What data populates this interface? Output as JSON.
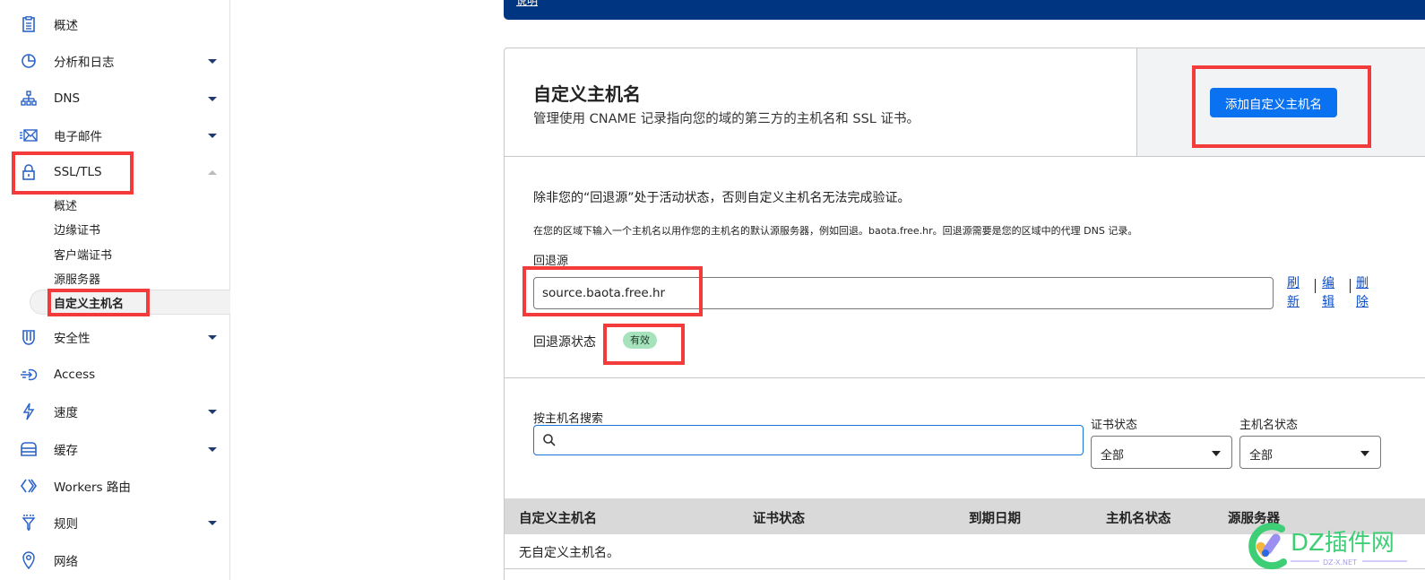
{
  "banner": {
    "link_text": "说明"
  },
  "sidebar": {
    "items": [
      {
        "label": "概述",
        "icon": "clipboard-icon",
        "has_caret": false
      },
      {
        "label": "分析和日志",
        "icon": "pie-chart-icon",
        "has_caret": true
      },
      {
        "label": "DNS",
        "icon": "network-tree-icon",
        "has_caret": true
      },
      {
        "label": "电子邮件",
        "icon": "envelope-icon",
        "has_caret": true
      },
      {
        "label": "SSL/TLS",
        "icon": "lock-icon",
        "has_caret": true,
        "expanded": true
      },
      {
        "label": "安全性",
        "icon": "shield-icon",
        "has_caret": true
      },
      {
        "label": "Access",
        "icon": "access-icon",
        "has_caret": false
      },
      {
        "label": "速度",
        "icon": "lightning-icon",
        "has_caret": true
      },
      {
        "label": "缓存",
        "icon": "storage-icon",
        "has_caret": true
      },
      {
        "label": "Workers 路由",
        "icon": "workers-icon",
        "has_caret": false
      },
      {
        "label": "规则",
        "icon": "filter-icon",
        "has_caret": true
      },
      {
        "label": "网络",
        "icon": "location-pin-icon",
        "has_caret": false
      }
    ],
    "ssl_sub_items": [
      {
        "label": "概述"
      },
      {
        "label": "边缘证书"
      },
      {
        "label": "客户端证书"
      },
      {
        "label": "源服务器"
      },
      {
        "label": "自定义主机名",
        "active": true
      }
    ]
  },
  "main": {
    "title": "自定义主机名",
    "description": "管理使用 CNAME 记录指向您的域的第三方的主机名和 SSL 证书。",
    "add_button": "添加自定义主机名",
    "warning": "除非您的“回退源”处于活动状态，否则自定义主机名无法完成验证。",
    "help": "在您的区域下输入一个主机名以用作您的主机名的默认源服务器，例如回退。baota.free.hr。回退源需要是您的区域中的代理 DNS 记录。",
    "fallback_label": "回退源",
    "fallback_value": "source.baota.free.hr",
    "actions": {
      "refresh": "刷新",
      "edit": "编辑",
      "delete": "删除"
    },
    "status_label": "回退源状态",
    "status_value": "有效",
    "status_color": "#a6e3bd",
    "search_label": "按主机名搜索",
    "search_value": "",
    "cert_status_label": "证书状态",
    "cert_status_value": "全部",
    "hostname_status_label": "主机名状态",
    "hostname_status_value": "全部",
    "table": {
      "columns": [
        "自定义主机名",
        "证书状态",
        "到期日期",
        "主机名状态",
        "源服务器"
      ],
      "empty_text": "无自定义主机名。"
    }
  },
  "watermark": {
    "text": "DZ插件网",
    "subtext": "DZ-X.NET"
  },
  "colors": {
    "accent": "#0a72f0",
    "banner": "#003681",
    "highlight": "#f43b3b",
    "link": "#0b4ec6"
  }
}
